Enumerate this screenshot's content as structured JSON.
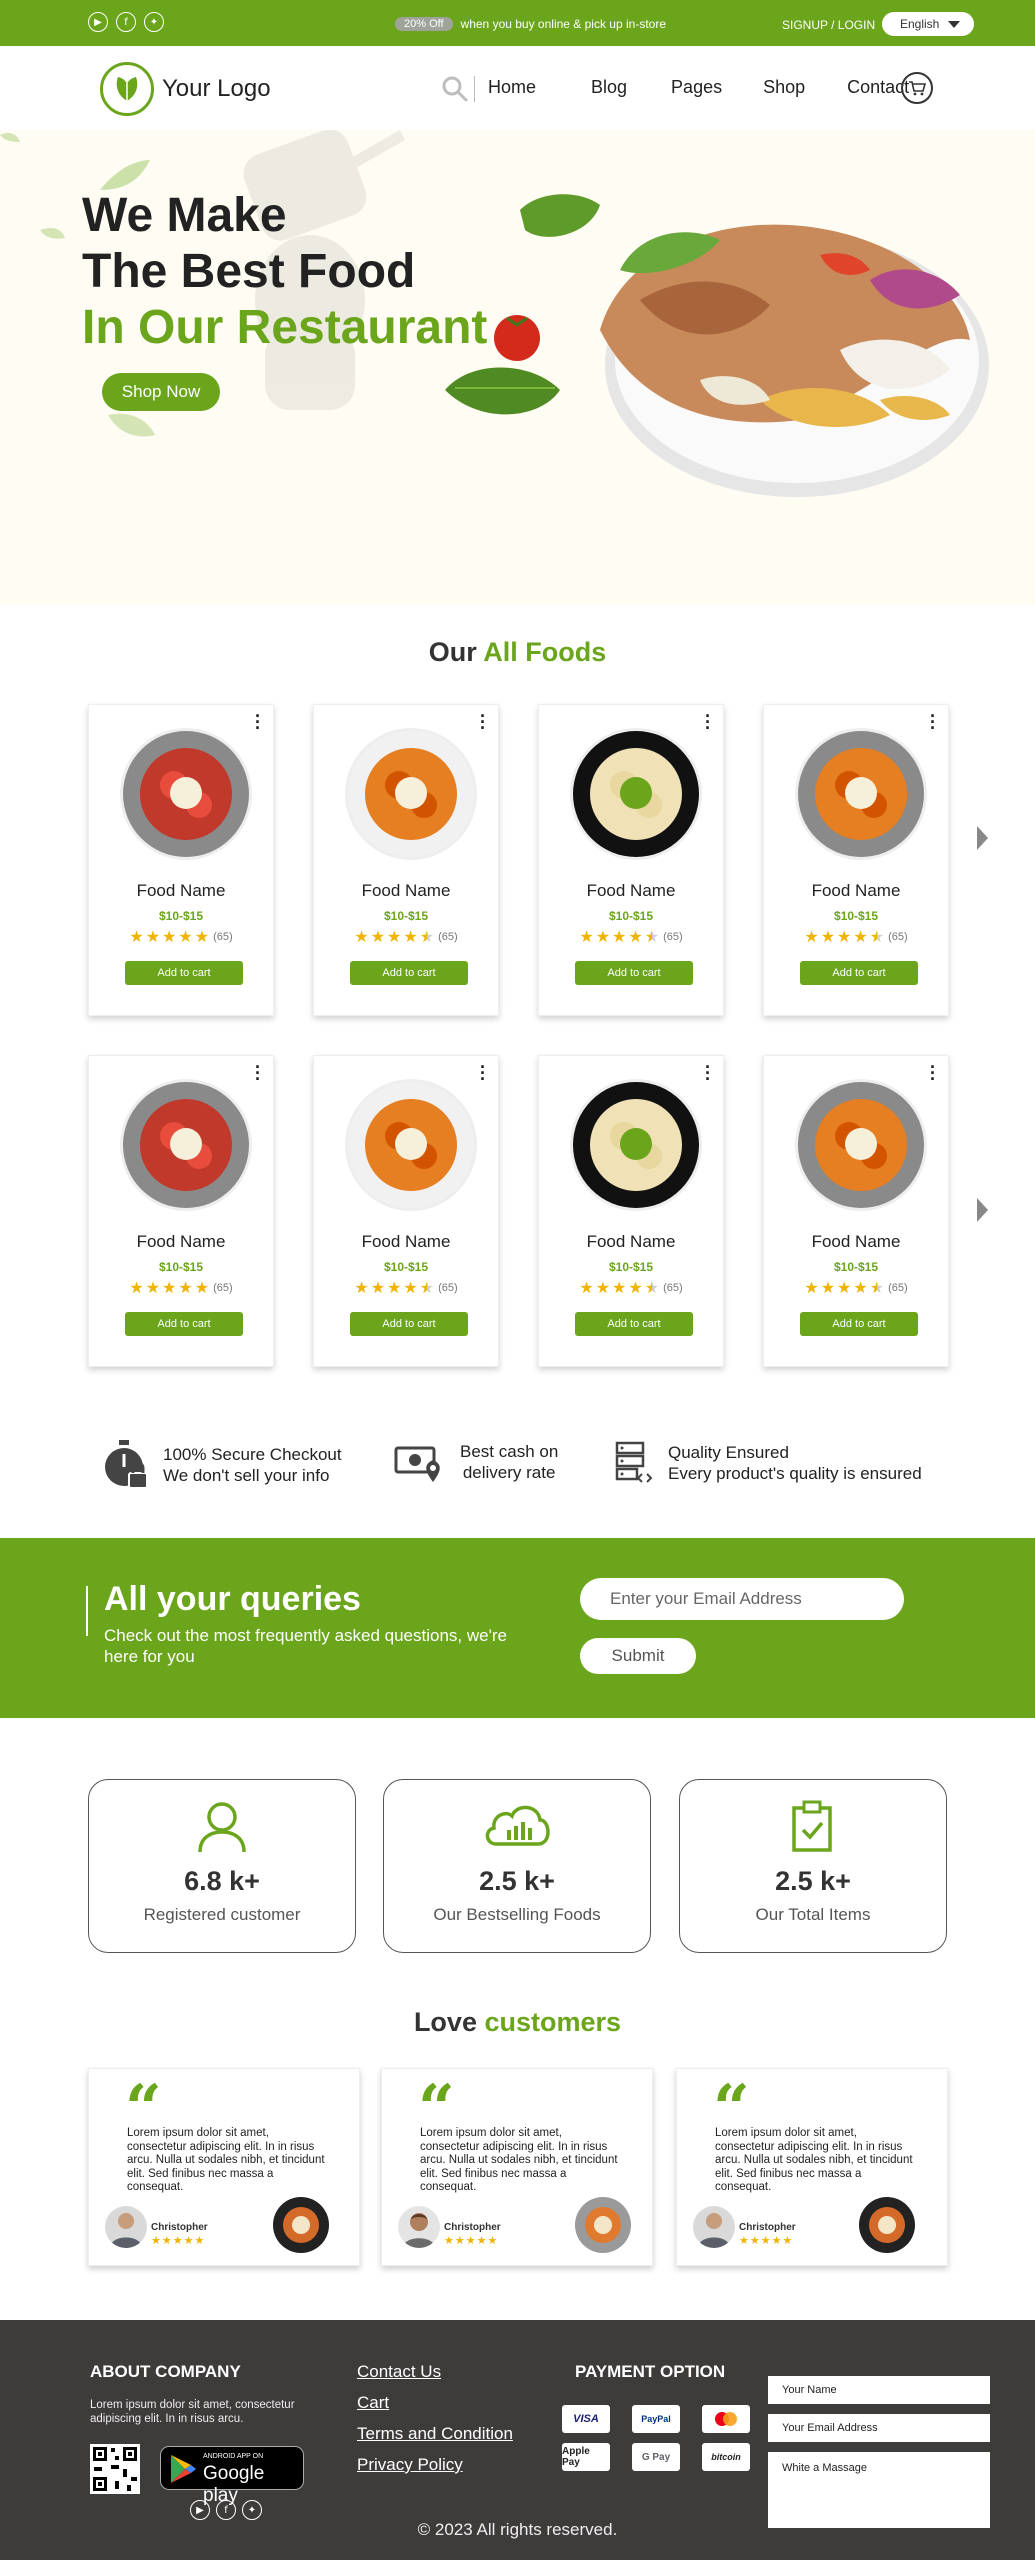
{
  "topbar": {
    "social_icons": [
      "youtube-icon",
      "facebook-icon",
      "twitter-icon"
    ],
    "promo_badge": "20% Off",
    "promo_text": "when you buy online & pick up in-store",
    "signin": "SIGNUP / LOGIN",
    "language": "English"
  },
  "nav": {
    "logo_text": "Your Logo",
    "links": [
      "Home",
      "Blog",
      "Pages",
      "Shop",
      "Contact"
    ]
  },
  "hero": {
    "line1": "We Make",
    "line2": "The Best Food",
    "line3": "In Our Restaurant",
    "cta": "Shop Now"
  },
  "foods": {
    "title_prefix": "Our",
    "title_accent": "All Foods",
    "rows": [
      [
        {
          "name": "Food Name",
          "price": "$10-$15",
          "rating": 5,
          "count": "(65)",
          "button": "Add to cart",
          "plate": "grey",
          "dish": "rigatoni"
        },
        {
          "name": "Food Name",
          "price": "$10-$15",
          "rating": 4.5,
          "count": "(65)",
          "button": "Add to cart",
          "plate": "white",
          "dish": "penne"
        },
        {
          "name": "Food Name",
          "price": "$10-$15",
          "rating": 4.5,
          "count": "(65)",
          "button": "Add to cart",
          "plate": "black",
          "dish": "spaghetti"
        },
        {
          "name": "Food Name",
          "price": "$10-$15",
          "rating": 4.5,
          "count": "(65)",
          "button": "Add to cart",
          "plate": "grey",
          "dish": "penne"
        }
      ],
      [
        {
          "name": "Food Name",
          "price": "$10-$15",
          "rating": 5,
          "count": "(65)",
          "button": "Add to cart",
          "plate": "grey",
          "dish": "rigatoni"
        },
        {
          "name": "Food Name",
          "price": "$10-$15",
          "rating": 4.5,
          "count": "(65)",
          "button": "Add to cart",
          "plate": "white",
          "dish": "penne"
        },
        {
          "name": "Food Name",
          "price": "$10-$15",
          "rating": 4.5,
          "count": "(65)",
          "button": "Add to cart",
          "plate": "black",
          "dish": "spaghetti"
        },
        {
          "name": "Food Name",
          "price": "$10-$15",
          "rating": 4.5,
          "count": "(65)",
          "button": "Add to cart",
          "plate": "grey",
          "dish": "penne"
        }
      ]
    ]
  },
  "features": [
    {
      "icon": "stopwatch-lock-icon",
      "line1": "100% Secure Checkout",
      "line2": "We don't sell your info"
    },
    {
      "icon": "cash-location-icon",
      "line1": "Best cash on",
      "line2": "delivery rate"
    },
    {
      "icon": "server-quality-icon",
      "line1": "Quality Ensured",
      "line2": "Every product's quality is ensured"
    }
  ],
  "queries": {
    "title": "All your queries",
    "text": "Check out the most frequently asked questions, we're here for you",
    "email_placeholder": "Enter your Email Address",
    "submit": "Submit"
  },
  "stats": [
    {
      "icon": "user-icon",
      "value": "6.8 k+",
      "label": "Registered customer"
    },
    {
      "icon": "cloud-chart-icon",
      "value": "2.5 k+",
      "label": "Our Bestselling Foods"
    },
    {
      "icon": "clipboard-check-icon",
      "value": "2.5 k+",
      "label": "Our Total Items"
    }
  ],
  "testimonials": {
    "title_prefix": "Love",
    "title_accent": "customers",
    "items": [
      {
        "text": "Lorem ipsum dolor sit amet, consectetur adipiscing elit. In in risus arcu. Nulla ut sodales nibh, et tincidunt elit. Sed finibus nec massa a consequat.",
        "name": "Christopher",
        "stars": "★★★★★"
      },
      {
        "text": "Lorem ipsum dolor sit amet, consectetur adipiscing elit. In in risus arcu. Nulla ut sodales nibh, et tincidunt elit. Sed finibus nec massa a consequat.",
        "name": "Christopher",
        "stars": "★★★★★"
      },
      {
        "text": "Lorem ipsum dolor sit amet, consectetur adipiscing elit. In in risus arcu. Nulla ut sodales nibh, et tincidunt elit. Sed finibus nec massa a consequat.",
        "name": "Christopher",
        "stars": "★★★★★"
      }
    ]
  },
  "footer": {
    "about_title": "ABOUT COMPANY",
    "about_text": "Lorem ipsum dolor sit amet, consectetur adipiscing elit. In in risus arcu.",
    "gplay_small": "ANDROID APP ON",
    "gplay_big": "Google play",
    "links": [
      "Contact Us",
      "Cart",
      "Terms and Condition",
      "Privacy Policy"
    ],
    "payment_title": "PAYMENT OPTION",
    "payments": [
      "VISA",
      "PayPal",
      "mastercard",
      "Apple Pay",
      "G Pay",
      "bitcoin"
    ],
    "name_placeholder": "Your Name",
    "email_placeholder": "Your Email Address",
    "message_placeholder": "White a Massage",
    "copyright": "© 2023 All rights reserved."
  },
  "colors": {
    "accent": "#6aa51c",
    "footer": "#3e3b3b",
    "star": "#f0b400",
    "hero_bg": "#fffcf3"
  }
}
